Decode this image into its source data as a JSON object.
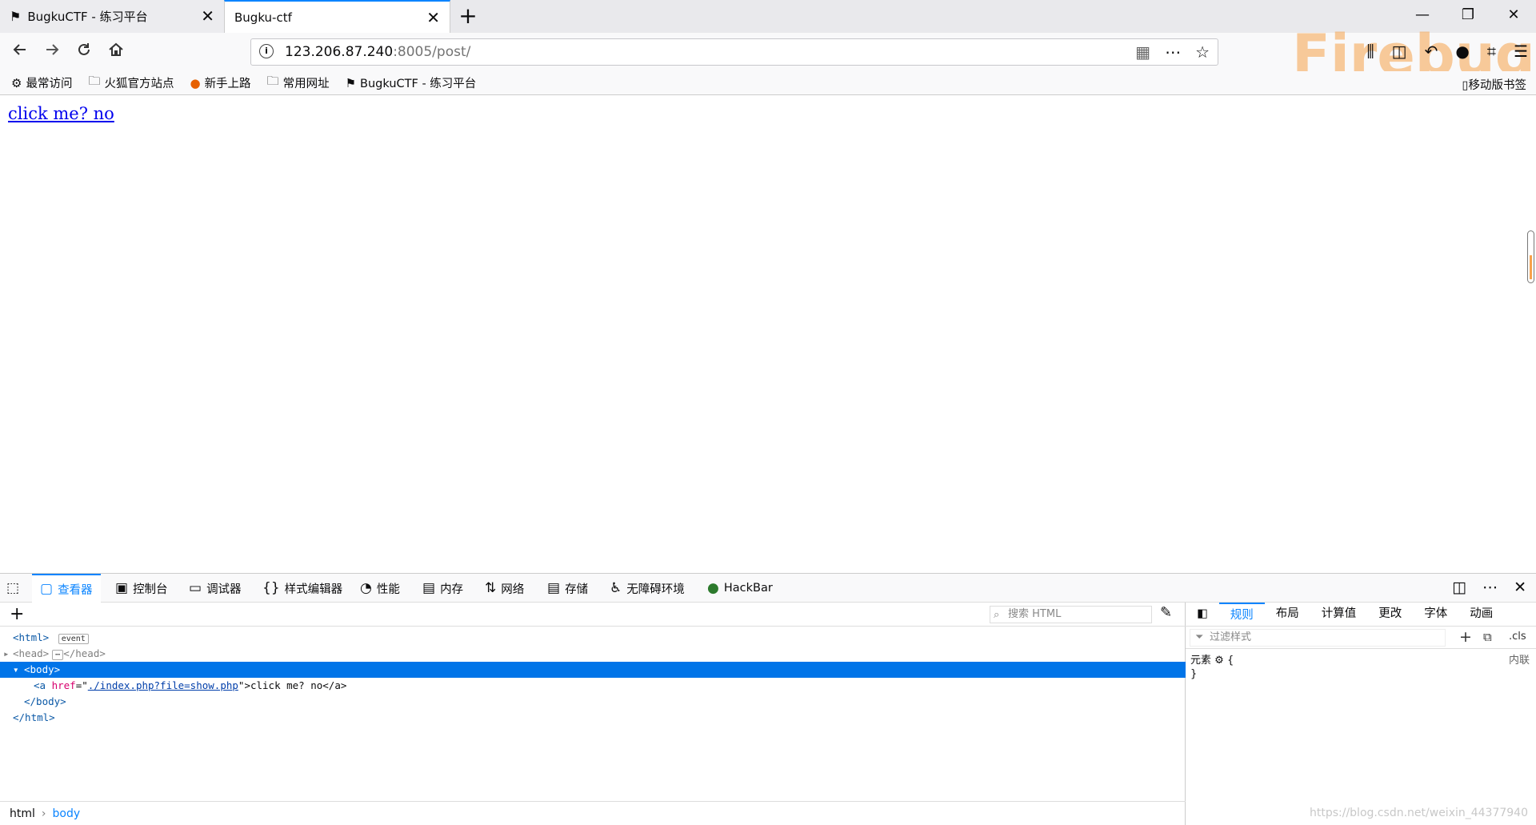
{
  "tabs": [
    {
      "title": "BugkuCTF - 练习平台",
      "icon": "flag-icon"
    },
    {
      "title": "Bugku-ctf",
      "active": true
    }
  ],
  "window_controls": {
    "minimize": "—",
    "restore": "❐",
    "close": "✕"
  },
  "url": {
    "host": "123.206.87.240",
    "rest": ":8005/post/"
  },
  "bookmarks": [
    {
      "label": "最常访问",
      "icon": "gear-icon"
    },
    {
      "label": "火狐官方站点",
      "icon": "folder-icon"
    },
    {
      "label": "新手上路",
      "icon": "firefox-icon"
    },
    {
      "label": "常用网址",
      "icon": "folder-icon"
    },
    {
      "label": "BugkuCTF - 练习平台",
      "icon": "flag-icon"
    }
  ],
  "mobile_bookmarks": "移动版书签",
  "firebug_logo": "Firebug",
  "page": {
    "link_text": "click me? no"
  },
  "devtools": {
    "tabs": [
      "查看器",
      "控制台",
      "调试器",
      "样式编辑器",
      "性能",
      "内存",
      "网络",
      "存储",
      "无障碍环境",
      "HackBar"
    ],
    "search_placeholder": "搜索 HTML",
    "tree": {
      "html_open": "<html>",
      "event_badge": "event",
      "head": "<head>",
      "head_ellipsis": "⋯",
      "head_close": "</head>",
      "body_open": "<body>",
      "a_open": "<a ",
      "a_attr_name": "href",
      "a_attr_value": "./index.php?file=show.php",
      "a_text": ">click me? no</a>",
      "body_close": "</body>",
      "html_close": "</html>"
    },
    "breadcrumb": [
      "html",
      "body"
    ],
    "rules_tabs": [
      "规则",
      "布局",
      "计算值",
      "更改",
      "字体",
      "动画"
    ],
    "filter_placeholder": "过滤样式",
    "cls_label": ".cls",
    "element_label": "元素",
    "open_brace": "{",
    "close_brace": "}",
    "inline_label": "内联"
  },
  "watermark": "https://blog.csdn.net/weixin_44377940"
}
